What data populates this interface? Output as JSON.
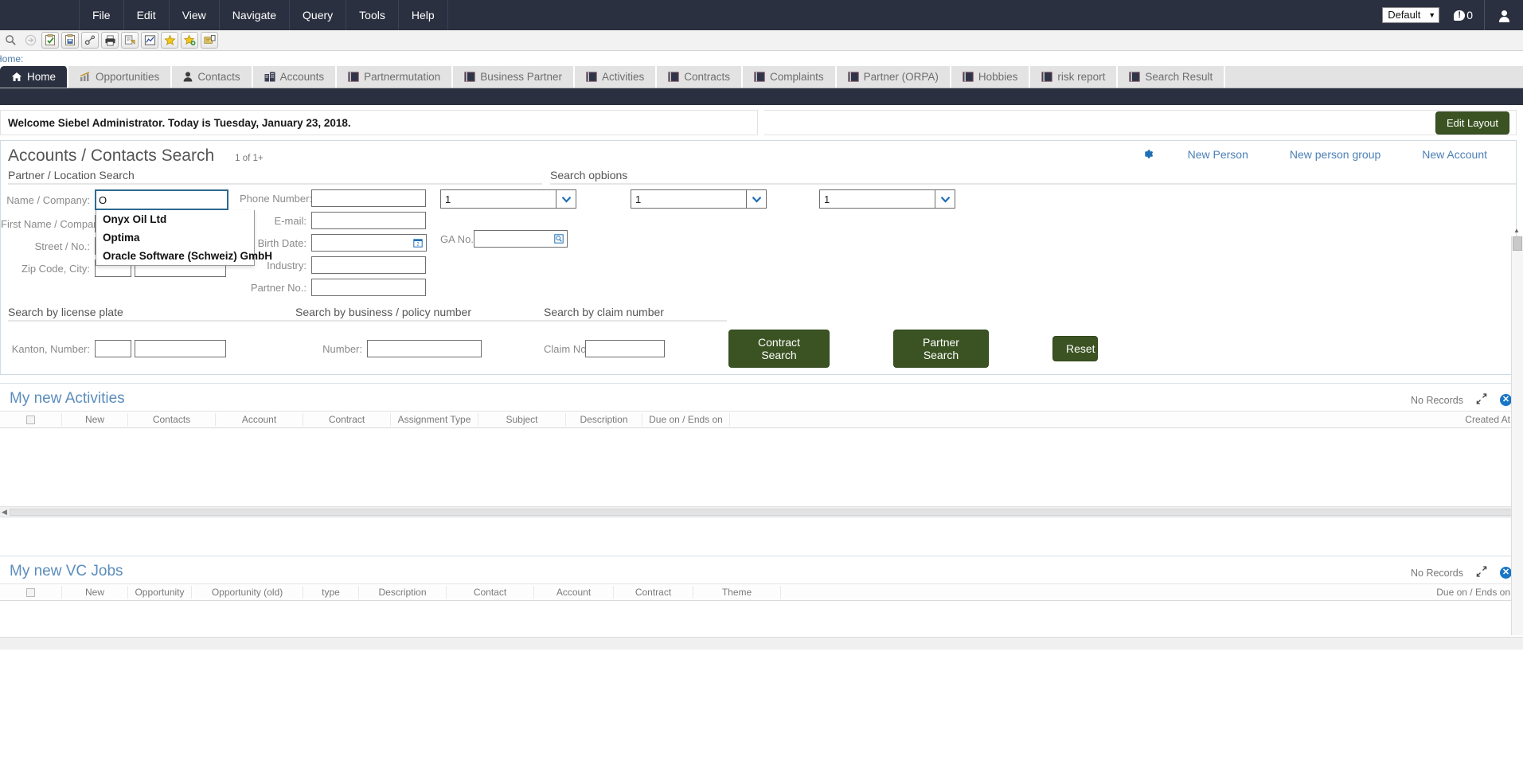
{
  "menubar": {
    "items": [
      "File",
      "Edit",
      "View",
      "Navigate",
      "Query",
      "Tools",
      "Help"
    ],
    "profile_value": "Default",
    "message_count": "0"
  },
  "toolbar": {
    "buttons": [
      "search-icon",
      "forward-arrow-icon",
      "new-record-icon",
      "save-record-icon",
      "link-icon",
      "print-icon",
      "report-icon",
      "chart-icon",
      "favorite-star-icon",
      "add-favorite-icon",
      "notes-icon"
    ]
  },
  "breadcrumb": {
    "text": "Home:"
  },
  "tabs": [
    {
      "label": "Home",
      "icon": "home-icon",
      "active": true
    },
    {
      "label": "Opportunities",
      "icon": "chart-up-icon",
      "active": false
    },
    {
      "label": "Contacts",
      "icon": "person-icon",
      "active": false
    },
    {
      "label": "Accounts",
      "icon": "building-icon",
      "active": false
    },
    {
      "label": "Partnermutation",
      "icon": "book-icon",
      "active": false
    },
    {
      "label": "Business Partner",
      "icon": "book-icon",
      "active": false
    },
    {
      "label": "Activities",
      "icon": "book-icon",
      "active": false
    },
    {
      "label": "Contracts",
      "icon": "book-icon",
      "active": false
    },
    {
      "label": "Complaints",
      "icon": "book-icon",
      "active": false
    },
    {
      "label": "Partner (ORPA)",
      "icon": "book-icon",
      "active": false
    },
    {
      "label": "Hobbies",
      "icon": "book-icon",
      "active": false
    },
    {
      "label": "risk report",
      "icon": "book-icon",
      "active": false
    },
    {
      "label": "Search Result",
      "icon": "book-icon",
      "active": false
    }
  ],
  "welcome": {
    "text": "Welcome Siebel Administrator.  Today is Tuesday, January 23, 2018.",
    "edit_layout_label": "Edit Layout"
  },
  "search_applet": {
    "title": "Accounts / Contacts Search",
    "record_count": "1 of 1+",
    "links": [
      "New Person",
      "New person group",
      "New Account"
    ],
    "gear_icon": "gear-icon",
    "sections": {
      "partner_location": "Partner / Location Search",
      "search_options": "Search opbions",
      "license_plate": "Search by license plate",
      "business_policy": "Search by business / policy number",
      "claim_number": "Search by claim number"
    },
    "left_fields": [
      {
        "label": "Name / Company:",
        "value": "O"
      },
      {
        "label": "First Name / Company:",
        "value": ""
      },
      {
        "label": "Street / No.:",
        "value": ""
      },
      {
        "label": "Zip Code, City:",
        "value": ""
      }
    ],
    "middle_fields": [
      {
        "label": "Phone Number:",
        "value": ""
      },
      {
        "label": "E-mail:",
        "value": ""
      },
      {
        "label": "Birth Date:",
        "value": "",
        "button": "calendar-icon"
      },
      {
        "label": "Industry:",
        "value": ""
      },
      {
        "label": "Partner No.:",
        "value": ""
      }
    ],
    "autocomplete": {
      "items": [
        "Onyx Oil Ltd",
        "Optima",
        "Oracle Software (Schweiz) GmbH"
      ]
    },
    "option_selects": [
      {
        "value": "1"
      },
      {
        "value": "1"
      },
      {
        "value": "1"
      }
    ],
    "ga_field": {
      "label": "GA No.:",
      "value": "",
      "button": "lookup-icon"
    },
    "license_plate_fields": {
      "label": "Kanton, Number:",
      "kanton": "",
      "number": ""
    },
    "business_field": {
      "label": "Number:",
      "value": ""
    },
    "claim_field": {
      "label": "Claim No.:",
      "value": ""
    },
    "buttons": [
      "Contract Search",
      "Partner Search",
      "Reset"
    ]
  },
  "activities_applet": {
    "title": "My new Activities",
    "status": "No Records",
    "collapse_icon": "collapse-icon",
    "close_icon": "close-icon",
    "columns": [
      "New",
      "Contacts",
      "Account",
      "Contract",
      "Assignment Type",
      "Subject",
      "Description",
      "Due on / Ends on",
      "Created At"
    ],
    "rows": []
  },
  "vcjobs_applet": {
    "title": "My new VC Jobs",
    "status": "No Records",
    "collapse_icon": "collapse-icon",
    "close_icon": "close-icon",
    "columns": [
      "New",
      "Opportunity",
      "Opportunity (old)",
      "type",
      "Description",
      "Contact",
      "Account",
      "Contract",
      "Theme",
      "Due on / Ends on"
    ],
    "rows": []
  },
  "colors": {
    "dark_chrome": "#2b3040",
    "green_button": "#3b5323",
    "link_blue": "#4a7fb5",
    "title_blue": "#5b8dbc",
    "focus_border": "#2e6a92"
  }
}
